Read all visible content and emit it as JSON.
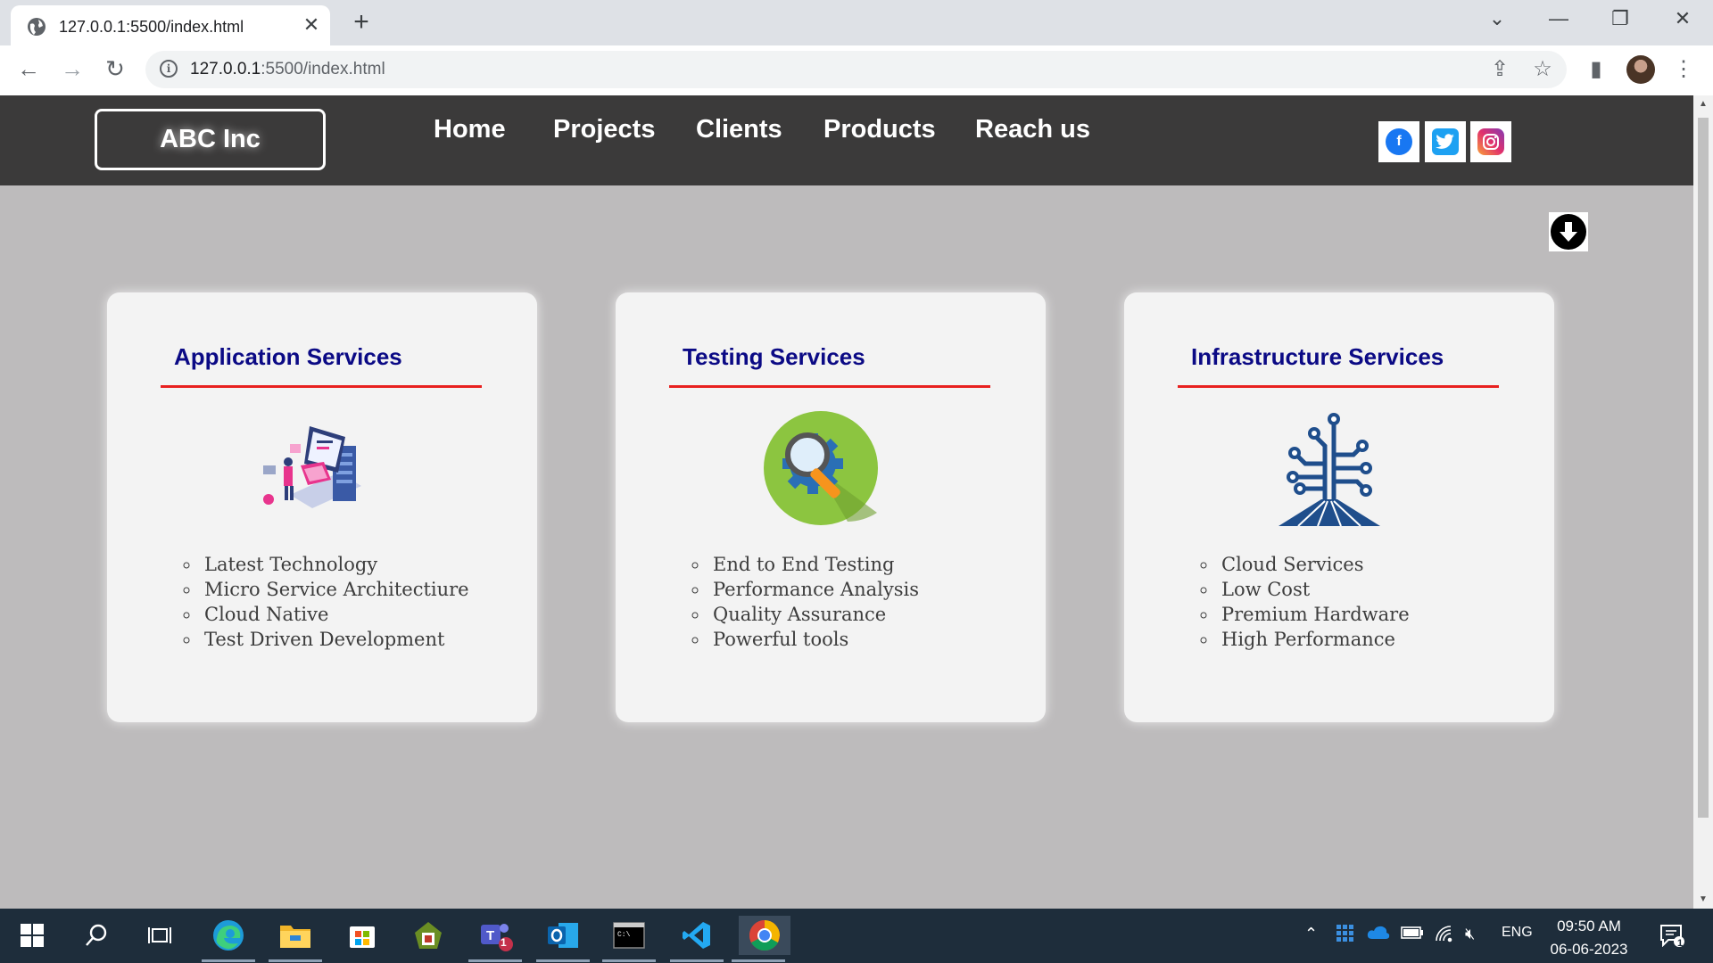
{
  "browser": {
    "tab_title": "127.0.0.1:5500/index.html",
    "url_host": "127.0.0.1",
    "url_rest": ":5500/index.html"
  },
  "site": {
    "logo": "ABC Inc",
    "nav": [
      "Home",
      "Projects",
      "Clients",
      "Products",
      "Reach us"
    ],
    "social": [
      "facebook-icon",
      "twitter-icon",
      "instagram-icon"
    ],
    "cards": [
      {
        "title": "Application Services",
        "items": [
          "Latest Technology",
          "Micro Service Architectiure",
          "Cloud Native",
          "Test Driven Development"
        ]
      },
      {
        "title": "Testing Services",
        "items": [
          "End to End Testing",
          "Performance Analysis",
          "Quality Assurance",
          "Powerful tools"
        ]
      },
      {
        "title": "Infrastructure Services",
        "items": [
          "Cloud Services",
          "Low Cost",
          "Premium Hardware",
          "High Performance"
        ]
      }
    ],
    "colors": {
      "navbar": "#3b3a3a",
      "background": "#bdbbbc",
      "card_title": "#0b0a85",
      "rule": "#e8201f"
    }
  },
  "taskbar": {
    "language": "ENG",
    "time": "09:50 AM",
    "date": "06-06-2023",
    "teams_badge": "1",
    "notification_count": "1"
  }
}
